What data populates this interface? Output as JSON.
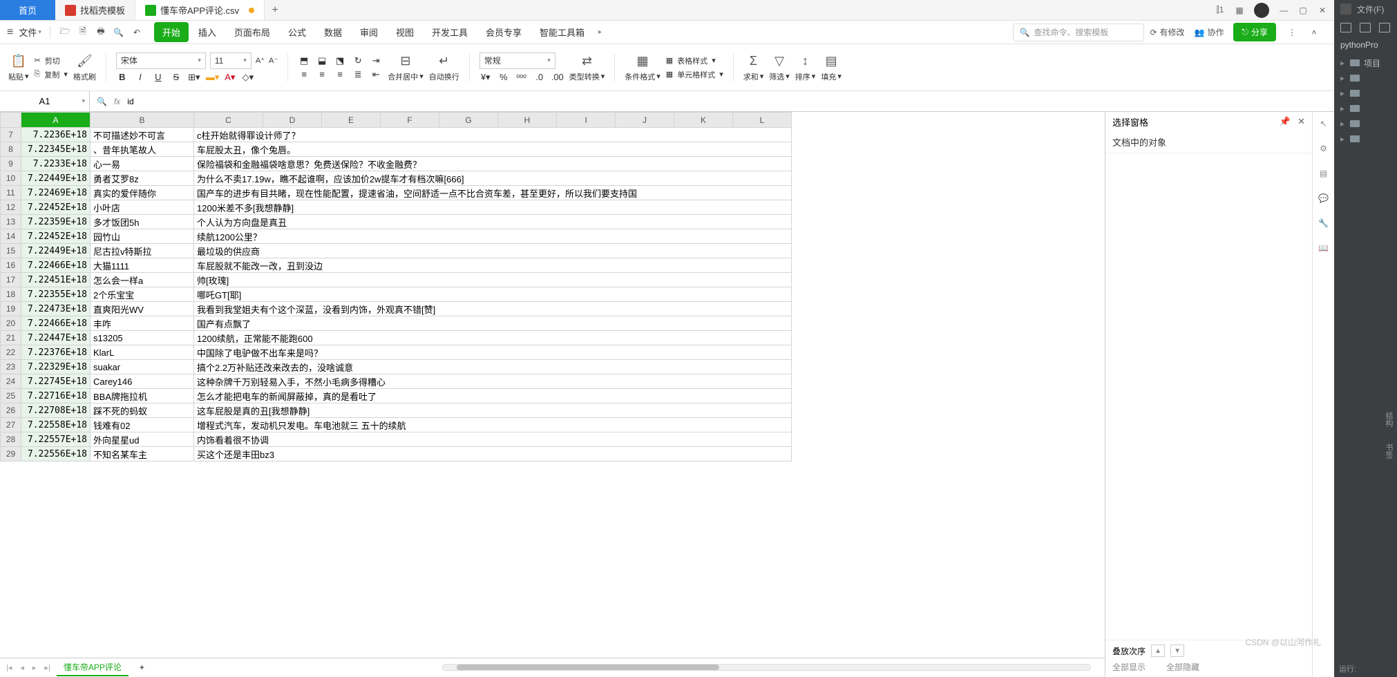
{
  "titlebar": {
    "home": "首页",
    "tab1": "找稻壳模板",
    "tab2": "懂车帝APP评论.csv",
    "plus": "+"
  },
  "menubar": {
    "file": "文件",
    "tabs": [
      "开始",
      "插入",
      "页面布局",
      "公式",
      "数据",
      "审阅",
      "视图",
      "开发工具",
      "会员专享",
      "智能工具箱"
    ],
    "active_tab_idx": 0,
    "search_placeholder": "查找命令、搜索模板",
    "changes": "有修改",
    "collab": "协作",
    "share": "分享"
  },
  "ribbon": {
    "paste": "粘贴",
    "cut": "剪切",
    "copy": "复制",
    "format_painter": "格式刷",
    "font_name": "宋体",
    "font_size": "11",
    "merge": "合并居中",
    "wrap": "自动换行",
    "currency_fmt": "常规",
    "type_conv": "类型转换",
    "conditional": "条件格式",
    "cell_style": "单元格样式",
    "table_style": "表格样式",
    "sum": "求和",
    "filter": "筛选",
    "sort": "排序",
    "fill": "填充"
  },
  "formula": {
    "ref": "A1",
    "content": "id"
  },
  "columns": [
    "A",
    "B",
    "C",
    "D",
    "E",
    "F",
    "G",
    "H",
    "I",
    "J",
    "K",
    "L"
  ],
  "rows": [
    {
      "n": 7,
      "a": "7.2236E+18",
      "b": "不可描述妙不可言",
      "c": "c柱开始就得罪设计师了？"
    },
    {
      "n": 8,
      "a": "7.22345E+18",
      "b": "、昔年执笔故人",
      "c": "车屁股太丑，像个兔唇。"
    },
    {
      "n": 9,
      "a": "7.2233E+18",
      "b": "心一易",
      "c": "保险福袋和金融福袋啥意思？免费送保险？不收金融费？"
    },
    {
      "n": 10,
      "a": "7.22449E+18",
      "b": "勇者艾罗8z",
      "c": "为什么不卖17.19w，瞧不起谁啊，应该加价2w提车才有档次嘛[666]"
    },
    {
      "n": 11,
      "a": "7.22469E+18",
      "b": "真实的爱伴随你",
      "c": "国产车的进步有目共睹，现在性能配置，提速省油，空间舒适一点不比合资车差，甚至更好，所以我们要支持国"
    },
    {
      "n": 12,
      "a": "7.22452E+18",
      "b": "小叶店",
      "c": "1200米差不多[我想静静]"
    },
    {
      "n": 13,
      "a": "7.22359E+18",
      "b": "多才饭团5h",
      "c": "个人认为方向盘是真丑"
    },
    {
      "n": 14,
      "a": "7.22452E+18",
      "b": "园竹山",
      "c": "续航1200公里？"
    },
    {
      "n": 15,
      "a": "7.22449E+18",
      "b": "尼古拉v特斯拉",
      "c": "最垃圾的供应商"
    },
    {
      "n": 16,
      "a": "7.22466E+18",
      "b": "大猫1111",
      "c": "车屁股就不能改一改，丑到没边"
    },
    {
      "n": 17,
      "a": "7.22451E+18",
      "b": "怎么会一样a",
      "c": "帅[玫瑰]"
    },
    {
      "n": 18,
      "a": "7.22355E+18",
      "b": "2个乐宝宝",
      "c": "哪吒GT[耶]"
    },
    {
      "n": 19,
      "a": "7.22473E+18",
      "b": "直爽阳光WV",
      "c": "我看到我堂姐夫有个这个深蓝，没看到内饰，外观真不错[赞]"
    },
    {
      "n": 20,
      "a": "7.22466E+18",
      "b": "丰咋",
      "c": "国产有点飘了"
    },
    {
      "n": 21,
      "a": "7.22447E+18",
      "b": "s13205",
      "c": "1200续航，正常能不能跑600"
    },
    {
      "n": 22,
      "a": "7.22376E+18",
      "b": "KlarL",
      "c": "中国除了电驴做不出车来是吗？"
    },
    {
      "n": 23,
      "a": "7.22329E+18",
      "b": "suakar",
      "c": "搞个2.2万补贴还改来改去的，没啥诚意"
    },
    {
      "n": 24,
      "a": "7.22745E+18",
      "b": "Carey146",
      "c": "这种杂牌千万别轻易入手，不然小毛病多得糟心"
    },
    {
      "n": 25,
      "a": "7.22716E+18",
      "b": "BBA牌拖拉机",
      "c": "怎么才能把电车的新闻屏蔽掉，真的是看吐了"
    },
    {
      "n": 26,
      "a": "7.22708E+18",
      "b": "踩不死的蚂蚁",
      "c": "这车屁股是真的丑[我想静静]"
    },
    {
      "n": 27,
      "a": "7.22558E+18",
      "b": "钱难有02",
      "c": "增程式汽车，发动机只发电。车电池就三 五十的续航"
    },
    {
      "n": 28,
      "a": "7.22557E+18",
      "b": "外向星星ud",
      "c": "内饰看着很不协调"
    },
    {
      "n": 29,
      "a": "7.22556E+18",
      "b": "不知名某车主",
      "c": "买这个还是丰田bz3"
    }
  ],
  "sheet_tab": {
    "name": "懂车帝APP评论",
    "plus": "+"
  },
  "panel": {
    "title": "选择窗格",
    "sub": "文档中的对象",
    "stack": "叠放次序",
    "show_all": "全部显示",
    "hide_all": "全部隐藏"
  },
  "ide": {
    "file_menu": "文件(F)",
    "project_label": "pythonPro",
    "tree_item": "项目",
    "vlabels": [
      "结构",
      "书签",
      "运行:"
    ]
  },
  "watermark": "CSDN @以山河作礼"
}
